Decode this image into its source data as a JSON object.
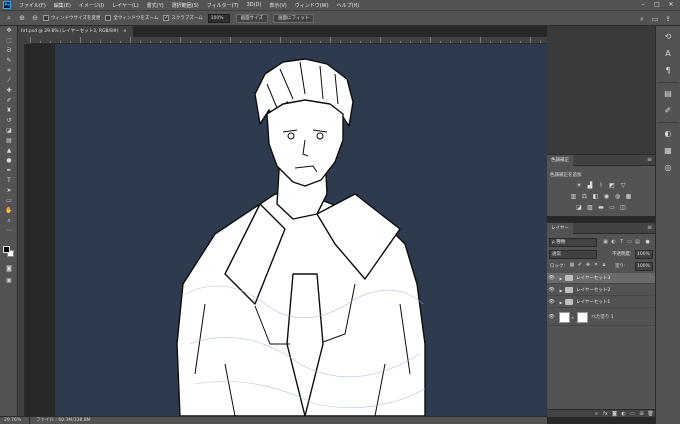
{
  "app": {
    "logo": "Ps"
  },
  "menu": [
    "ファイル(F)",
    "編集(E)",
    "イメージ(I)",
    "レイヤー(L)",
    "書式(Y)",
    "選択範囲(S)",
    "フィルター(T)",
    "3D(D)",
    "表示(V)",
    "ウィンドウ(W)",
    "ヘルプ(H)"
  ],
  "window_controls": {
    "minimize": "–",
    "maximize": "□",
    "close": "✕"
  },
  "options_bar": {
    "resize_windows_label": "ウィンドウサイズを変更",
    "zoom_all_label": "全ウィンドウをズーム",
    "scrubby_zoom_label": "スクラブズーム",
    "scrubby_zoom_checked": true,
    "zoom_value": "100%",
    "fit_screen_button": "画面サイズ",
    "fill_screen_button": "画面にフィット"
  },
  "document": {
    "tab_title": "hrt.psd @ 29.8% (レイヤーセット3, RGB/8#)",
    "tab_close": "×"
  },
  "status_bar": {
    "zoom": "29.76%",
    "doc_info": "ファイル : 60.3M/338.8M"
  },
  "adjustments": {
    "tab_label": "色調補正",
    "add_label": "色調補正を追加"
  },
  "layers": {
    "tab_label": "レイヤー",
    "filter_label": "ρ 種類",
    "blend_mode": "通常",
    "opacity_label": "不透明度:",
    "opacity_value": "100%",
    "lock_label": "ロック:",
    "fill_label": "塗り:",
    "fill_value": "100%",
    "items": [
      {
        "name": "レイヤーセット3",
        "selected": true
      },
      {
        "name": "レイヤーセット2",
        "selected": false
      },
      {
        "name": "レイヤーセット1",
        "selected": false
      },
      {
        "name": "べた塗り 1",
        "selected": false
      }
    ]
  },
  "colors": {
    "canvas_background": "#2e3a4d",
    "panel": "#535353",
    "accent": "#31a8ff"
  }
}
